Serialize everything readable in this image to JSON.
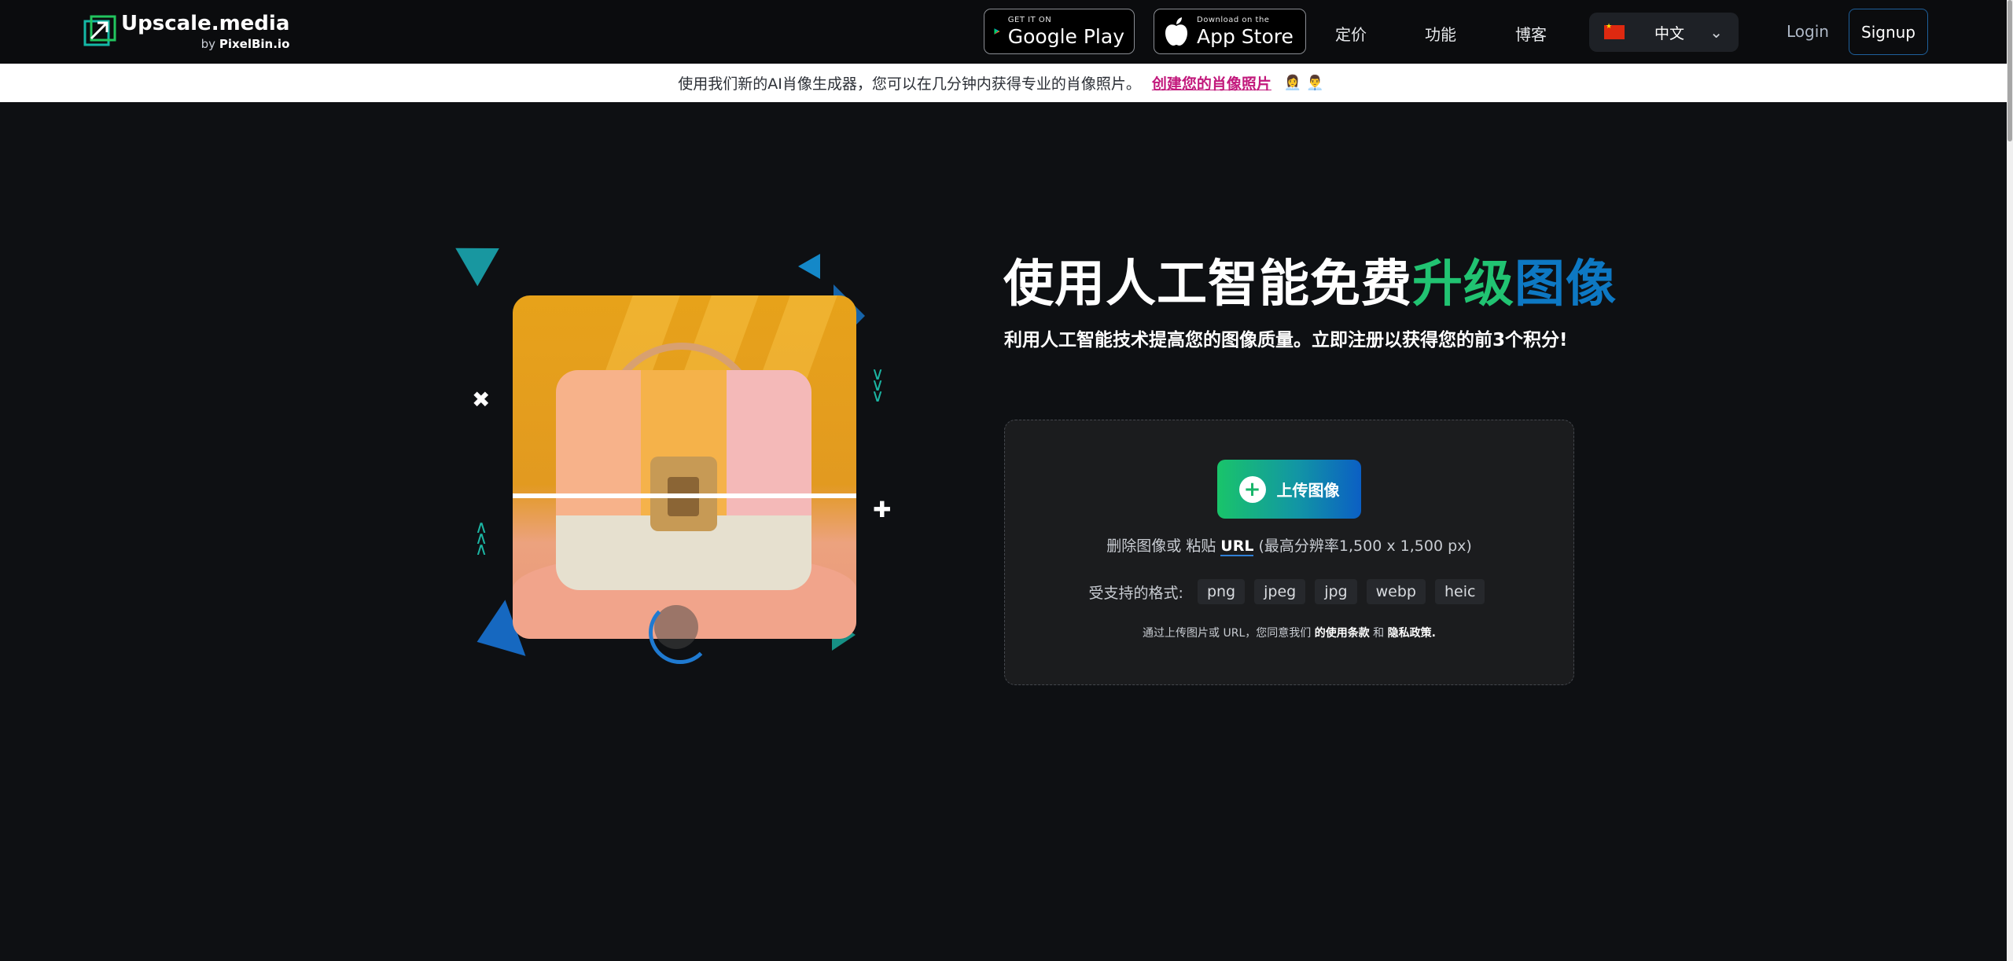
{
  "header": {
    "logo_name": "Upscale.media",
    "logo_by_prefix": "by",
    "logo_by_brand": "PixelBin.io",
    "google_play": {
      "small": "GET IT ON",
      "big": "Google Play"
    },
    "app_store": {
      "small": "Download on the",
      "big": "App Store"
    },
    "nav": {
      "pricing": "定价",
      "features": "功能",
      "blog": "博客"
    },
    "language": {
      "selected": "中文",
      "flag": "china-flag"
    },
    "login_label": "Login",
    "signup_label": "Signup"
  },
  "announcement": {
    "text": "使用我们新的AI肖像生成器，您可以在几分钟内获得专业的肖像照片。",
    "link": "创建您的肖像照片",
    "emojis": "👩‍💼👨‍💼"
  },
  "hero": {
    "title_white": "使用人工智能免费",
    "title_green": "升级",
    "title_blue": "图像",
    "subtitle": "利用人工智能技术提高您的图像质量。立即注册以获得您的前3个积分!"
  },
  "upload": {
    "button_label": "上传图像",
    "drop_prefix": "删除图像或 粘贴",
    "drop_url": "URL",
    "drop_suffix": "(最高分辨率1,500 x 1,500 px)",
    "formats_label": "受支持的格式:",
    "formats": [
      "png",
      "jpeg",
      "jpg",
      "webp",
      "heic"
    ],
    "terms_prefix": "通过上传图片或 URL，您同意我们",
    "terms_link": "的使用条款",
    "terms_and": "和",
    "privacy_link": "隐私政策."
  },
  "colors": {
    "background": "#0e1013",
    "accent_green": "#21c372",
    "accent_blue": "#0d78c3",
    "announcement_link": "#c2197c"
  }
}
